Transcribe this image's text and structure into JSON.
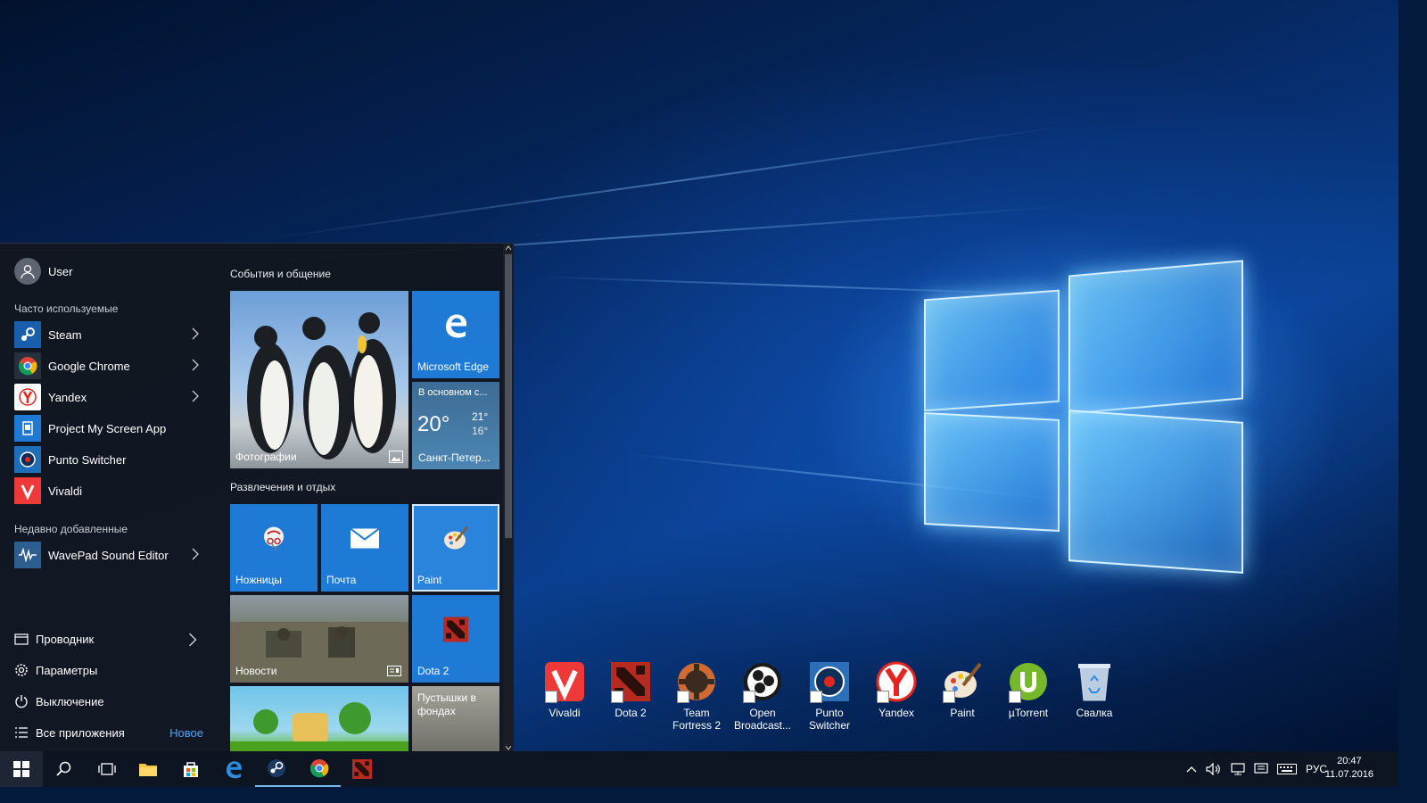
{
  "start_menu": {
    "user": "User",
    "frequent_title": "Часто используемые",
    "frequent": [
      {
        "label": "Steam",
        "icon": "steam-icon",
        "has_arrow": true
      },
      {
        "label": "Google Chrome",
        "icon": "chrome-icon",
        "has_arrow": true
      },
      {
        "label": "Yandex",
        "icon": "yandex-icon",
        "has_arrow": true
      },
      {
        "label": "Project My Screen App",
        "icon": "project-screen-icon",
        "has_arrow": false
      },
      {
        "label": "Punto Switcher",
        "icon": "punto-switcher-icon",
        "has_arrow": false
      },
      {
        "label": "Vivaldi",
        "icon": "vivaldi-icon",
        "has_arrow": false
      }
    ],
    "recent_title": "Недавно добавленные",
    "recent": [
      {
        "label": "WavePad Sound Editor",
        "icon": "wavepad-icon",
        "has_arrow": true
      }
    ],
    "system": {
      "explorer": "Проводник",
      "settings": "Параметры",
      "power": "Выключение",
      "all_apps": "Все приложения",
      "new_badge": "Новое"
    },
    "groups": [
      {
        "title": "События и общение"
      },
      {
        "title": "Развлечения и отдых"
      }
    ],
    "tiles": {
      "photos": "Фотографии",
      "edge": "Microsoft Edge",
      "weather": {
        "summary": "В основном с...",
        "temp": "20°",
        "high": "21°",
        "low": "16°",
        "city": "Санкт-Петер..."
      },
      "snipping": "Ножницы",
      "mail": "Почта",
      "paint": "Paint",
      "news": "Новости",
      "dota": "Dota 2",
      "game": "Пустышки в фондах"
    }
  },
  "desktop_icons": [
    {
      "label": "Vivaldi",
      "icon": "vivaldi-icon"
    },
    {
      "label": "Dota 2",
      "icon": "dota-icon"
    },
    {
      "label": "Team Fortress 2",
      "icon": "team-fortress-icon"
    },
    {
      "label": "Open Broadcast...",
      "icon": "obs-icon"
    },
    {
      "label": "Punto Switcher",
      "icon": "punto-switcher-icon"
    },
    {
      "label": "Yandex",
      "icon": "yandex-icon"
    },
    {
      "label": "Paint",
      "icon": "paint-icon"
    },
    {
      "label": "µTorrent",
      "icon": "utorrent-icon"
    },
    {
      "label": "Свалка",
      "icon": "recycle-bin-icon"
    }
  ],
  "taskbar": {
    "lang": "РУС",
    "time": "20:47",
    "date": "11.07.2016"
  },
  "colors": {
    "accent": "#1f7ad6",
    "menu_bg": "#12161e",
    "taskbar_bg": "#0d1522"
  }
}
